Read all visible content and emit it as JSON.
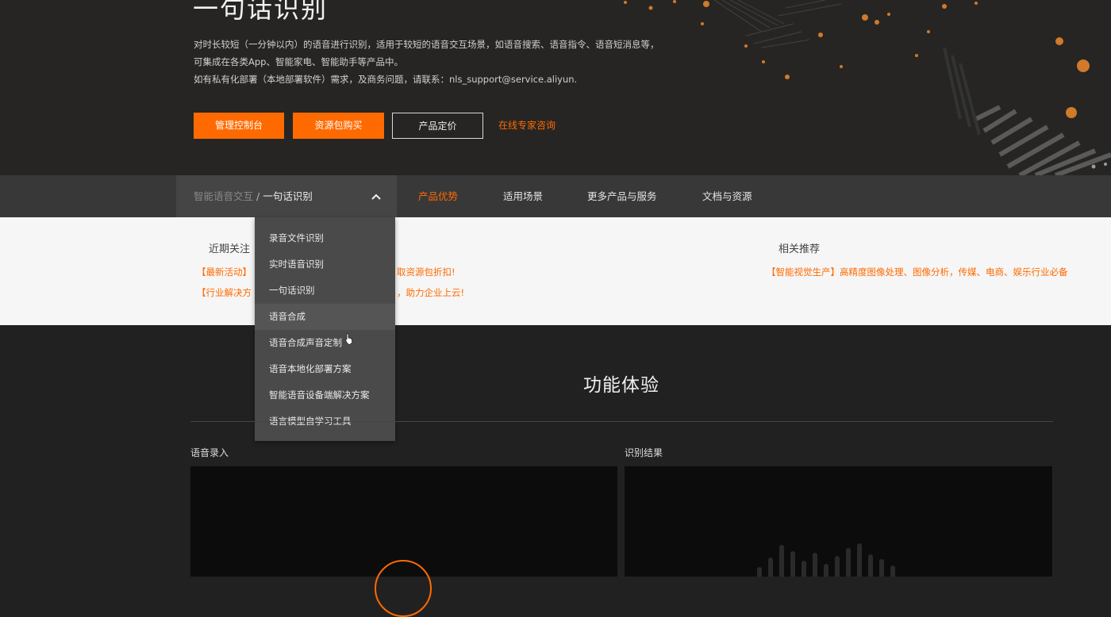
{
  "hero": {
    "title": "一句话识别",
    "desc": [
      "对时长较短（一分钟以内）的语音进行识别，适用于较短的语音交互场景，如语音搜索、语音指令、语音短消息等，",
      "可集成在各类App、智能家电、智能助手等产品中。",
      "如有私有化部署（本地部署软件）需求，及商务问题，请联系：nls_support@service.aliyun."
    ],
    "buttons": {
      "console": "管理控制台",
      "buy": "资源包购买",
      "pricing": "产品定价",
      "consult": "在线专家咨询"
    },
    "accent_color": "#ff6a00"
  },
  "nav": {
    "breadcrumb_parent": "智能语音交互",
    "breadcrumb_sep": "/",
    "breadcrumb_current": "一句话识别",
    "tabs": [
      "产品优势",
      "适用场景",
      "更多产品与服务",
      "文档与资源"
    ],
    "active_tab": "产品优势"
  },
  "dropdown": {
    "items": [
      "录音文件识别",
      "实时语音识别",
      "一句话识别",
      "语音合成",
      "语音合成声音定制",
      "语音本地化部署方案",
      "智能语音设备端解决方案",
      "语言模型自学习工具"
    ],
    "hovered": "语音合成"
  },
  "panel": {
    "recent_title": "近期关注",
    "recent_links": [
      {
        "tag": "【最新活动】",
        "text": "取资源包折扣!"
      },
      {
        "tag": "【行业解决方",
        "text": "，助力企业上云!"
      }
    ],
    "related_title": "相关推荐",
    "related_link": "【智能视觉生产】高精度图像处理、图像分析，传媒、电商、娱乐行业必备"
  },
  "feature": {
    "title": "功能体验",
    "input_label": "语音录入",
    "result_label": "识别结果"
  }
}
